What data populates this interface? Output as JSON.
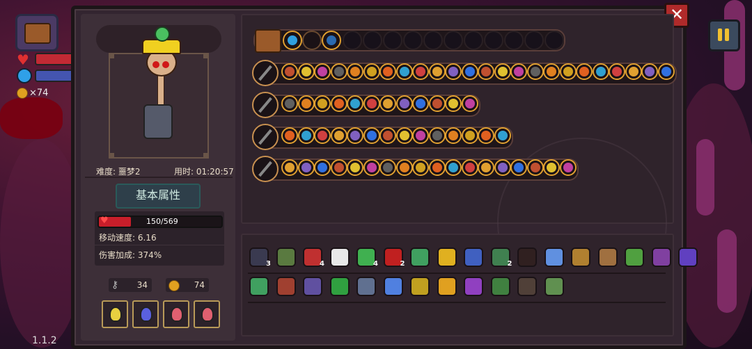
{
  "hud": {
    "coin_count": "×74",
    "version": "1.1.2"
  },
  "close_label": "✕",
  "character": {
    "difficulty": "难度: 噩梦2",
    "time": "用时: 01:20:57",
    "attributes_tab": "基本属性",
    "hp_text": "150/569",
    "hp_fraction": 0.264,
    "move_speed": "移动速度: 6.16",
    "damage_bonus": "伤害加成: 374%",
    "keys": "34",
    "coins": "74"
  },
  "potions": [
    {
      "color": "#e8d040"
    },
    {
      "color": "#5a60e0"
    },
    {
      "color": "#e06070"
    },
    {
      "color": "#e06070"
    }
  ],
  "weapon_rows": [
    {
      "count": 24
    },
    {
      "count": 12
    },
    {
      "count": 14
    },
    {
      "count": 18
    }
  ],
  "items": [
    {
      "color": "#3a3a50",
      "count": "3"
    },
    {
      "color": "#5a7a40",
      "count": ""
    },
    {
      "color": "#c03030",
      "count": "4"
    },
    {
      "color": "#e8e8e8",
      "count": ""
    },
    {
      "color": "#40b050",
      "count": "4"
    },
    {
      "color": "#c02020",
      "count": "2"
    },
    {
      "color": "#40a060",
      "count": ""
    },
    {
      "color": "#e0b020",
      "count": ""
    },
    {
      "color": "#4060c0",
      "count": ""
    },
    {
      "color": "#408050",
      "count": "2"
    },
    {
      "color": "#302020",
      "count": ""
    },
    {
      "color": "#6090e0",
      "count": ""
    },
    {
      "color": "#b08030",
      "count": ""
    },
    {
      "color": "#a07040",
      "count": ""
    },
    {
      "color": "#50a040",
      "count": ""
    },
    {
      "color": "#8040a0",
      "count": ""
    },
    {
      "color": "#6040c0",
      "count": ""
    },
    {
      "color": "#40a060",
      "count": ""
    },
    {
      "color": "#a04030",
      "count": ""
    },
    {
      "color": "#6050a0",
      "count": ""
    },
    {
      "color": "#30a040",
      "count": ""
    },
    {
      "color": "#607090",
      "count": ""
    },
    {
      "color": "#5080e0",
      "count": ""
    },
    {
      "color": "#c0a020",
      "count": ""
    },
    {
      "color": "#e0a020",
      "count": ""
    },
    {
      "color": "#9040c0",
      "count": ""
    },
    {
      "color": "#408040",
      "count": ""
    },
    {
      "color": "#504038",
      "count": ""
    },
    {
      "color": "#609050",
      "count": ""
    }
  ]
}
